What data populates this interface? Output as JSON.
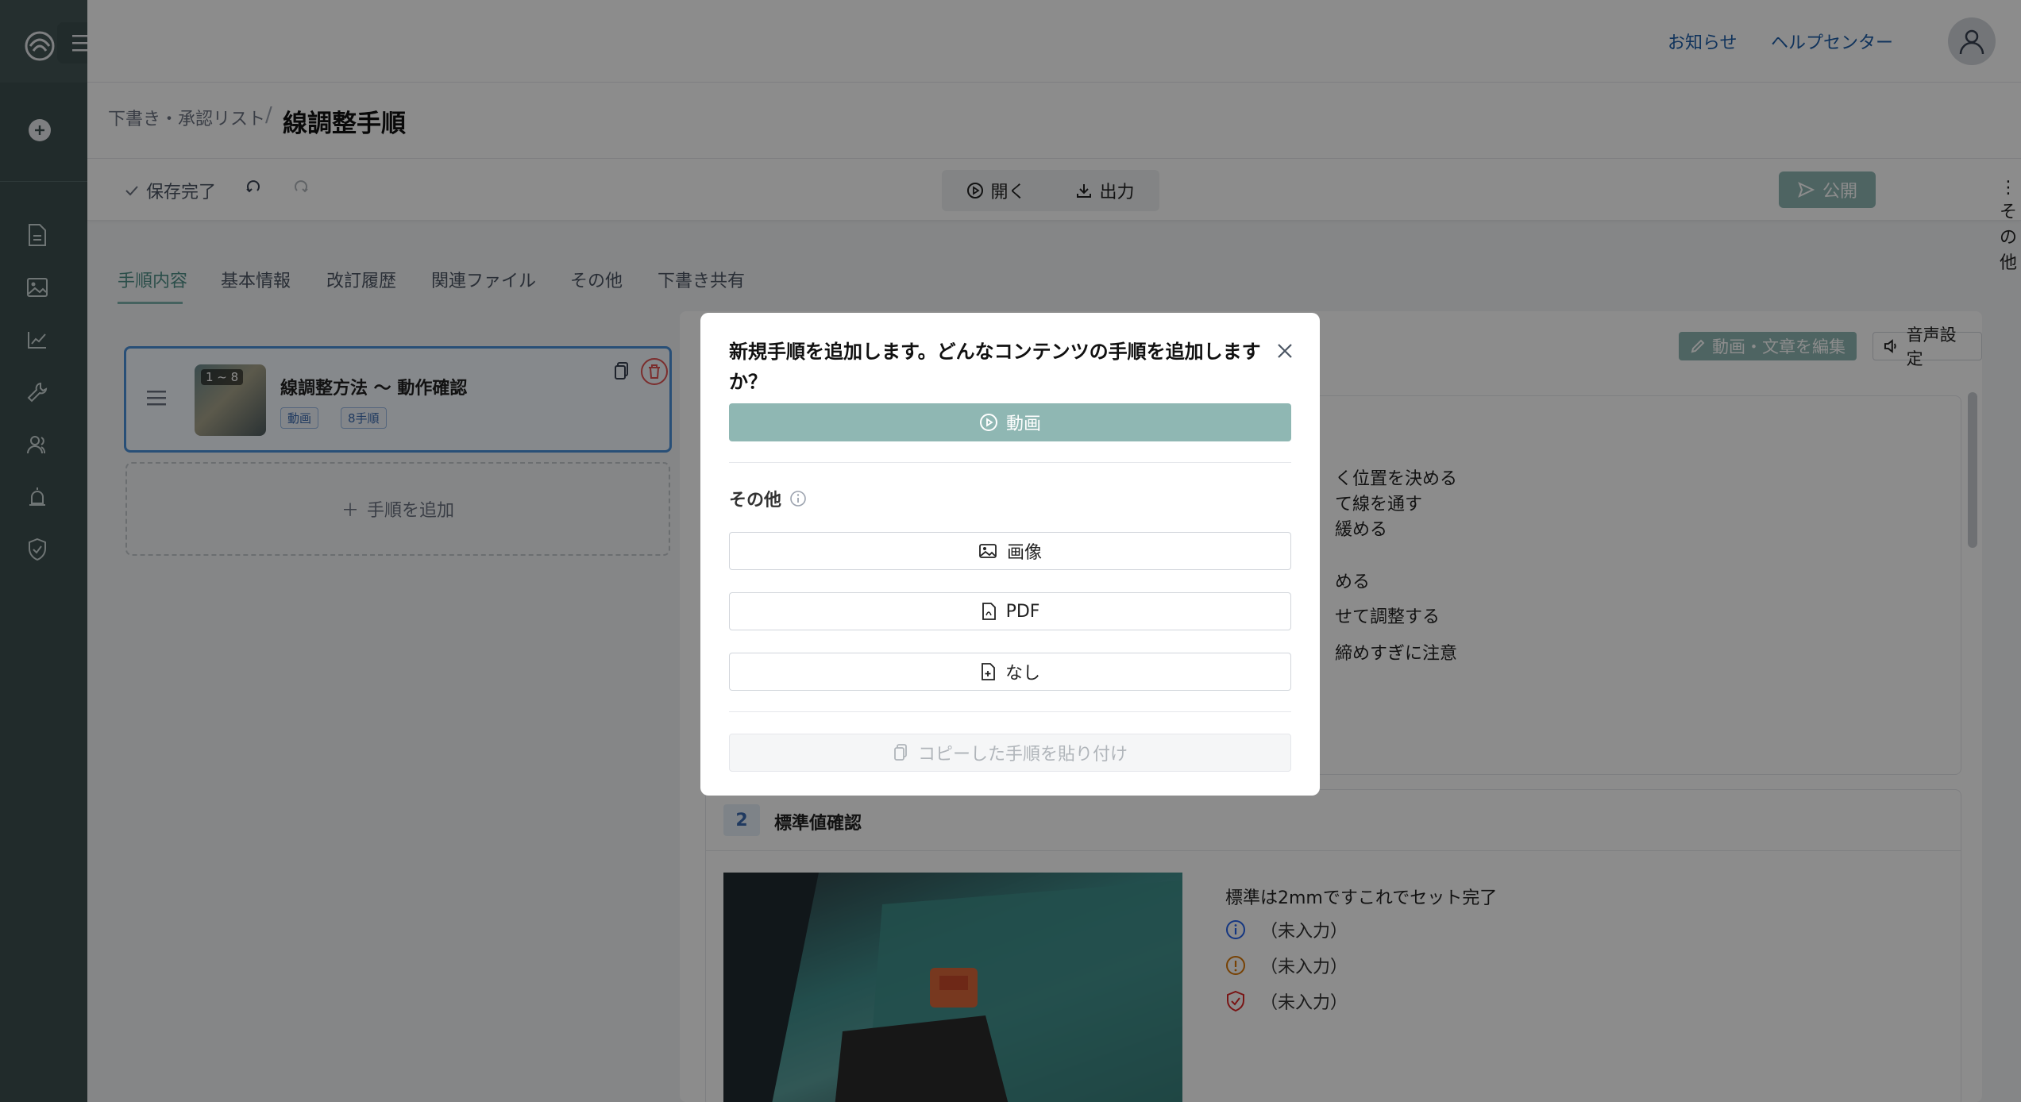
{
  "header": {
    "notifications_label": "お知らせ",
    "help_center_label": "ヘルプセンター"
  },
  "breadcrumb": {
    "parent": "下書き・承認リスト",
    "separator": "/",
    "current": "線調整手順"
  },
  "toolbar": {
    "save_status": "保存完了",
    "open_label": "開く",
    "export_label": "出力",
    "publish_label": "公開",
    "more_label": "その他"
  },
  "tabs": [
    {
      "label": "手順内容",
      "active": true
    },
    {
      "label": "基本情報",
      "active": false
    },
    {
      "label": "改訂履歴",
      "active": false
    },
    {
      "label": "関連ファイル",
      "active": false
    },
    {
      "label": "その他",
      "active": false
    },
    {
      "label": "下書き共有",
      "active": false
    }
  ],
  "step_card": {
    "range_label": "1 ~ 8",
    "title": "線調整方法 〜 動作確認",
    "tags": [
      "動画",
      "8手順"
    ]
  },
  "add_step_label": "手順を追加",
  "content": {
    "edit_button": "動画・文章を編集",
    "voice_button": "音声設定",
    "step1_lines": [
      "く位置を決める",
      "て線を通す",
      "緩める",
      "める",
      "せて調整する",
      "締めすぎに注意"
    ],
    "step2": {
      "number": "2",
      "title": "標準値確認",
      "text": "標準は2mmですこれでセット完了",
      "rows": [
        {
          "icon": "info-icon",
          "text": "（未入力）",
          "color": "#2563eb"
        },
        {
          "icon": "warning-icon",
          "text": "（未入力）",
          "color": "#d97706"
        },
        {
          "icon": "shield-check-icon",
          "text": "（未入力）",
          "color": "#dc2626"
        }
      ]
    }
  },
  "modal": {
    "title": "新規手順を追加します。どんなコンテンツの手順を追加しますか？",
    "video_label": "動画",
    "other_section_label": "その他",
    "image_label": "画像",
    "pdf_label": "PDF",
    "none_label": "なし",
    "paste_label": "コピーした手順を貼り付け"
  },
  "colors": {
    "sidebar": "#3d4f4f",
    "accent": "#8fb7b3",
    "tab_active": "#4f8f88",
    "selection_border": "#4a90d9",
    "delete_red": "#e05252"
  }
}
